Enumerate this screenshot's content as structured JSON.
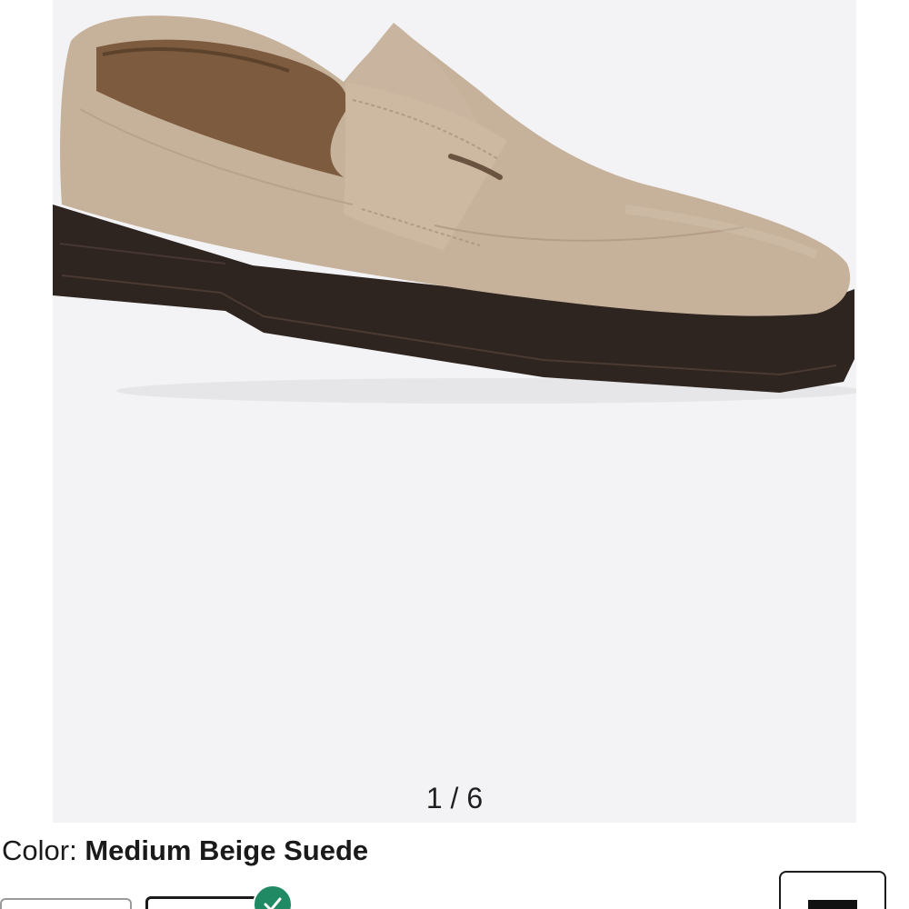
{
  "gallery": {
    "image_counter": "1 / 6",
    "image_icon": "suede-penny-loafer-image"
  },
  "color": {
    "label": "Color:",
    "value": "Medium Beige Suede"
  },
  "swatches": {
    "selected_icon": "check-icon",
    "accent": "#1f8a63"
  },
  "colors": {
    "suede": "#c6b29b",
    "sole": "#2e2420",
    "background": "#f3f3f5"
  }
}
